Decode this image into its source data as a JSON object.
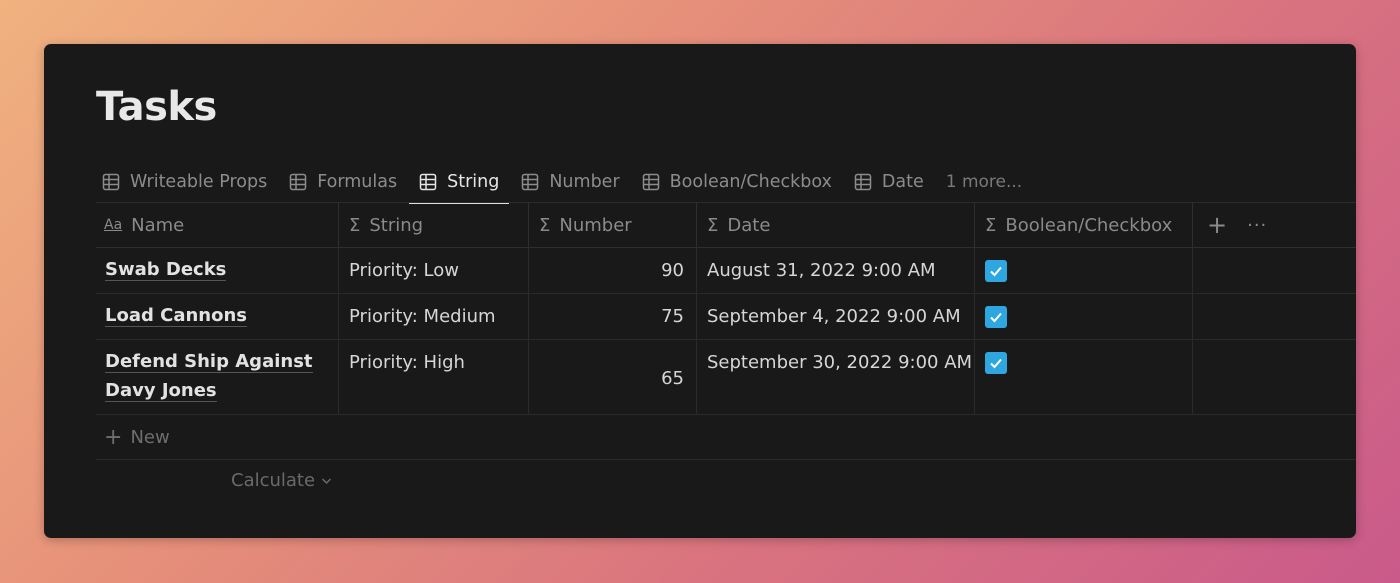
{
  "page": {
    "title": "Tasks"
  },
  "tabs": [
    {
      "label": "Writeable Props",
      "active": false
    },
    {
      "label": "Formulas",
      "active": false
    },
    {
      "label": "String",
      "active": true
    },
    {
      "label": "Number",
      "active": false
    },
    {
      "label": "Boolean/Checkbox",
      "active": false
    },
    {
      "label": "Date",
      "active": false
    }
  ],
  "tabs_more": "1 more...",
  "columns": {
    "name": "Name",
    "string": "String",
    "number": "Number",
    "date": "Date",
    "boolean": "Boolean/Checkbox"
  },
  "icons": {
    "name_column": "Aa",
    "formula_column": "Σ",
    "add_column": "+",
    "more": "···",
    "tab": "table-icon",
    "checkbox": "check-icon"
  },
  "rows": [
    {
      "name": "Swab Decks",
      "string": "Priority: Low",
      "number": "90",
      "date": "August 31, 2022 9:00 AM",
      "checked": true
    },
    {
      "name": "Load Cannons",
      "string": "Priority: Medium",
      "number": "75",
      "date": "September 4, 2022 9:00 AM",
      "checked": true
    },
    {
      "name": "Defend Ship Against Davy Jones",
      "string": "Priority: High",
      "number": "65",
      "date": "September 30, 2022 9:00 AM",
      "checked": true
    }
  ],
  "new_row": {
    "label": "New",
    "icon": "+"
  },
  "calculate": {
    "label": "Calculate",
    "icon": "⌄"
  },
  "colors": {
    "background": "#191919",
    "checkbox": "#2ea7e0",
    "text": "#d6d6d6",
    "muted": "#8a8a8a"
  }
}
